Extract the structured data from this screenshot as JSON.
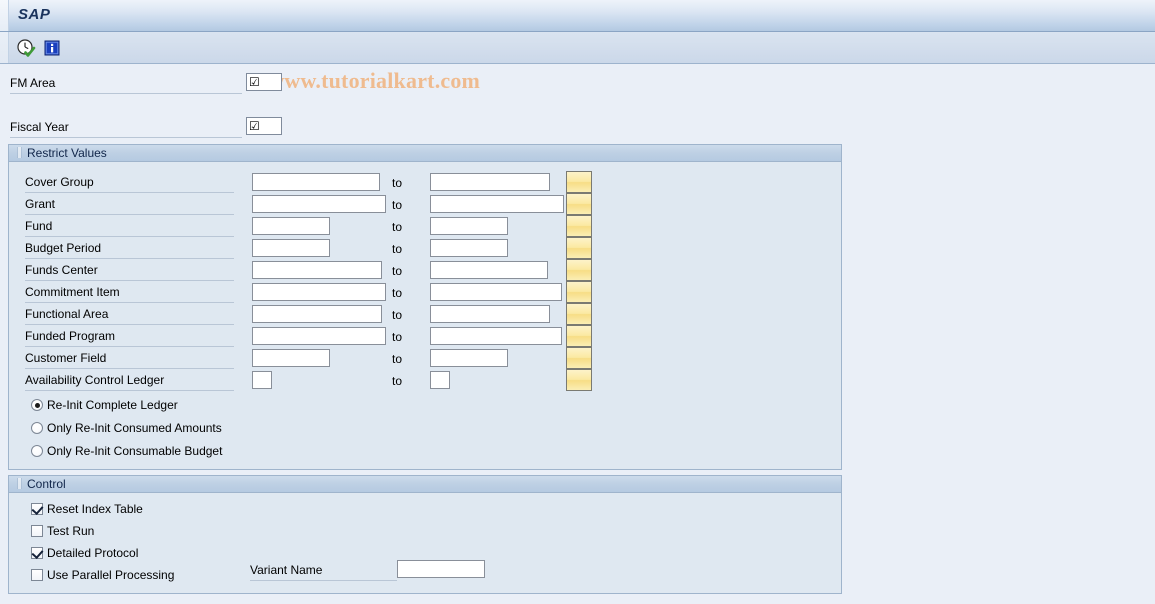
{
  "window": {
    "title": "SAP",
    "watermark": "© www.tutorialkart.com"
  },
  "toolbar": {
    "execute_icon": "execute-clock-check-icon",
    "info_icon": "information-icon"
  },
  "top_fields": [
    {
      "label": "FM Area",
      "value": "☑"
    },
    {
      "label": "Fiscal Year",
      "value": "☑"
    }
  ],
  "restrict": {
    "header": "Restrict Values",
    "to_label": "to",
    "rows": [
      {
        "label": "Cover Group",
        "from": "",
        "to": "",
        "from_w": 128,
        "to_w": 120
      },
      {
        "label": "Grant",
        "from": "",
        "to": "",
        "from_w": 134,
        "to_w": 134
      },
      {
        "label": "Fund",
        "from": "",
        "to": "",
        "from_w": 78,
        "to_w": 78
      },
      {
        "label": "Budget Period",
        "from": "",
        "to": "",
        "from_w": 78,
        "to_w": 78
      },
      {
        "label": "Funds Center",
        "from": "",
        "to": "",
        "from_w": 130,
        "to_w": 118
      },
      {
        "label": "Commitment Item",
        "from": "",
        "to": "",
        "from_w": 134,
        "to_w": 132
      },
      {
        "label": "Functional Area",
        "from": "",
        "to": "",
        "from_w": 130,
        "to_w": 120
      },
      {
        "label": "Funded Program",
        "from": "",
        "to": "",
        "from_w": 134,
        "to_w": 132
      },
      {
        "label": "Customer Field",
        "from": "",
        "to": "",
        "from_w": 78,
        "to_w": 78
      },
      {
        "label": "Availability Control Ledger",
        "from": "",
        "to": "",
        "from_w": 20,
        "to_w": 20
      }
    ],
    "multi_select_icon": "multiple-selection-button",
    "radios": [
      {
        "label": "Re-Init Complete Ledger",
        "selected": true
      },
      {
        "label": "Only Re-Init Consumed Amounts",
        "selected": false
      },
      {
        "label": "Only Re-Init Consumable Budget",
        "selected": false
      }
    ]
  },
  "control": {
    "header": "Control",
    "checkboxes": [
      {
        "label": "Reset Index Table",
        "checked": true
      },
      {
        "label": "Test Run",
        "checked": false
      },
      {
        "label": "Detailed Protocol",
        "checked": true
      },
      {
        "label": "Use Parallel Processing",
        "checked": false
      }
    ],
    "variant": {
      "label": "Variant Name",
      "value": "",
      "placeholder": ""
    }
  },
  "colors": {
    "page_bg": "#eaeff7",
    "panel_bg": "#dfe8f1",
    "panel_border": "#9fb4cc",
    "header_grad_top": "#ccdbeb",
    "header_grad_bottom": "#b5cae1",
    "title_text": "#19325c",
    "watermark": "#f0b98a",
    "multiselect_yellow": "#fbe9a2",
    "field_border": "#898f99"
  }
}
